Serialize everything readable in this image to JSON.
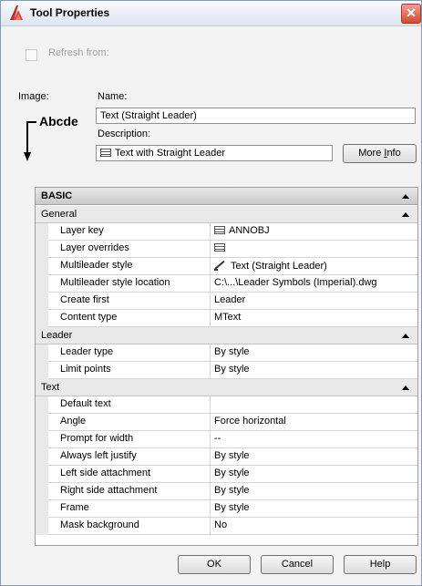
{
  "window": {
    "title": "Tool Properties",
    "close_glyph": "✕"
  },
  "refresh": {
    "label": "Refresh from:"
  },
  "image": {
    "label": "Image:",
    "preview_text": "Abcde"
  },
  "name": {
    "label": "Name:",
    "value": "Text (Straight Leader)"
  },
  "description": {
    "label": "Description:",
    "value": "Text with Straight Leader"
  },
  "more_info": {
    "label_pre": "More ",
    "label_underlined": "I",
    "label_post": "nfo"
  },
  "grid": {
    "section": "BASIC",
    "categories": [
      {
        "name": "General",
        "properties": [
          {
            "name": "Layer key",
            "value": "ANNOBJ",
            "icon": "list-icon"
          },
          {
            "name": "Layer overrides",
            "value": "",
            "icon": "list-icon"
          },
          {
            "name": "Multileader style",
            "value": "Text (Straight Leader)",
            "icon": "leader-icon"
          },
          {
            "name": "Multileader style location",
            "value": "C:\\...\\Leader Symbols (Imperial).dwg"
          },
          {
            "name": "Create first",
            "value": "Leader"
          },
          {
            "name": "Content type",
            "value": "MText"
          }
        ]
      },
      {
        "name": "Leader",
        "properties": [
          {
            "name": "Leader type",
            "value": "By style"
          },
          {
            "name": "Limit points",
            "value": "By style"
          }
        ]
      },
      {
        "name": "Text",
        "properties": [
          {
            "name": "Default text",
            "value": ""
          },
          {
            "name": "Angle",
            "value": "Force horizontal"
          },
          {
            "name": "Prompt for width",
            "value": "--"
          },
          {
            "name": "Always left justify",
            "value": "By style"
          },
          {
            "name": "Left side attachment",
            "value": "By style"
          },
          {
            "name": "Right side attachment",
            "value": "By style"
          },
          {
            "name": "Frame",
            "value": "By style"
          },
          {
            "name": "Mask background",
            "value": "No"
          }
        ]
      }
    ]
  },
  "buttons": {
    "ok": "OK",
    "cancel": "Cancel",
    "help": "Help"
  },
  "colors": {
    "accent": "#d24a2e",
    "header": "#c9c9c9"
  }
}
